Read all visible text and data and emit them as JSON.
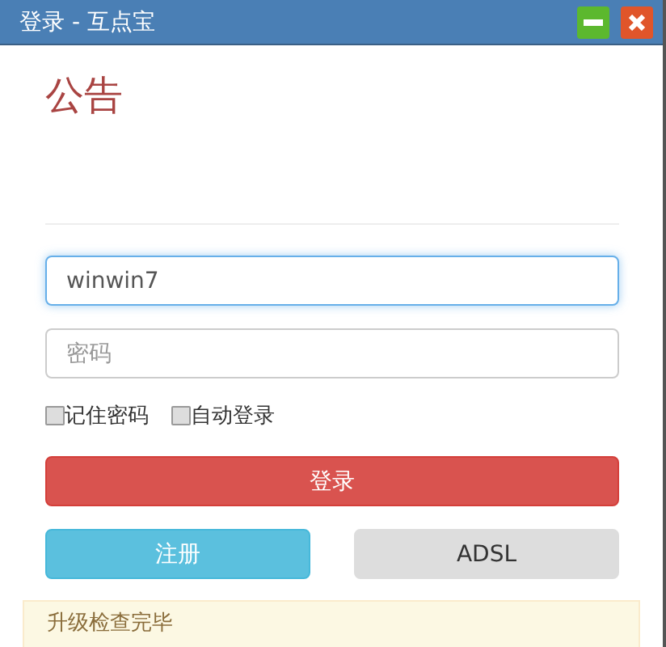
{
  "window": {
    "title": "登录 - 互点宝"
  },
  "announcement": {
    "title": "公告"
  },
  "username": {
    "value": "winwin7"
  },
  "password": {
    "placeholder": "密码"
  },
  "options": [
    {
      "label": "记住密码",
      "checked": false
    },
    {
      "label": "自动登录",
      "checked": false
    }
  ],
  "login_button": "登录",
  "buttons": [
    {
      "label": "注册",
      "kind": "info"
    },
    {
      "label": "ADSL",
      "kind": "default"
    }
  ],
  "notice": "升级检查完毕"
}
